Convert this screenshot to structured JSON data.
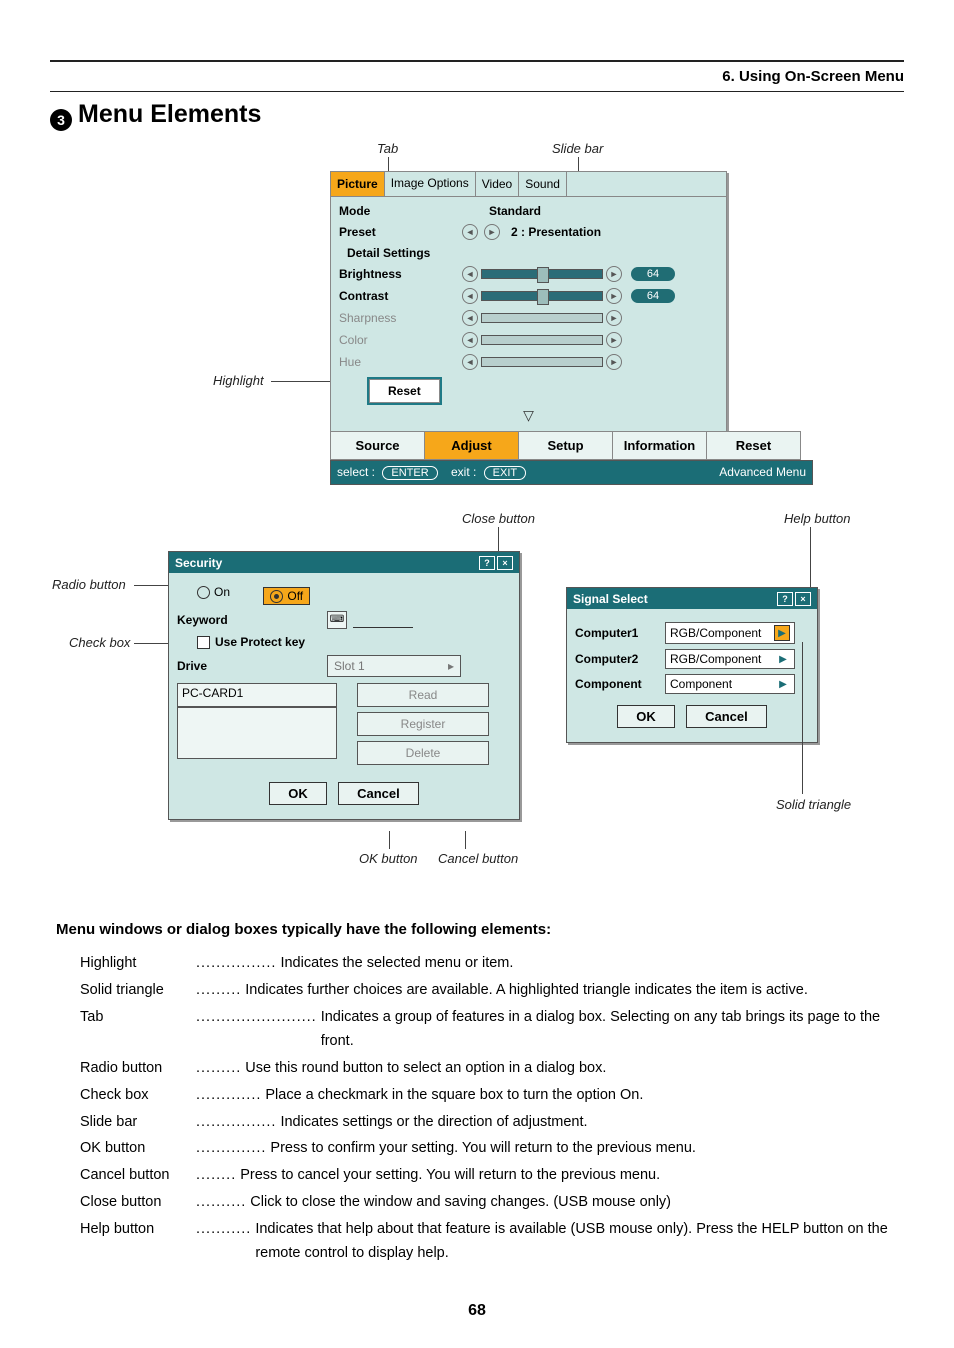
{
  "chapter": "6. Using On-Screen Menu",
  "section_number": "3",
  "section_title": "Menu Elements",
  "page_number": "68",
  "callouts": {
    "tab": "Tab",
    "slide_bar": "Slide bar",
    "highlight": "Highlight",
    "close_button": "Close button",
    "help_button": "Help button",
    "radio_button": "Radio button",
    "check_box": "Check box",
    "solid_triangle": "Solid triangle",
    "ok_button": "OK button",
    "cancel_button": "Cancel button"
  },
  "osd": {
    "tabs": [
      "Picture",
      "Image Options",
      "Video",
      "Sound"
    ],
    "rows": {
      "mode": {
        "label": "Mode",
        "value": "Standard"
      },
      "preset": {
        "label": "Preset",
        "value": "2 : Presentation"
      },
      "detail": {
        "label": "Detail Settings"
      },
      "brightness": {
        "label": "Brightness",
        "value": "64"
      },
      "contrast": {
        "label": "Contrast",
        "value": "64"
      },
      "sharpness": {
        "label": "Sharpness"
      },
      "color": {
        "label": "Color"
      },
      "hue": {
        "label": "Hue"
      },
      "reset": {
        "label": "Reset"
      }
    },
    "main_tabs": [
      "Source",
      "Adjust",
      "Setup",
      "Information",
      "Reset"
    ],
    "status": {
      "select": "select :",
      "select_btn": "ENTER",
      "exit": "exit :",
      "exit_btn": "EXIT",
      "right": "Advanced Menu"
    }
  },
  "security": {
    "title": "Security",
    "on": "On",
    "off": "Off",
    "keyword": "Keyword",
    "use_protect": "Use Protect key",
    "drive": "Drive",
    "drive_val": "Slot 1",
    "pc_card": "PC-CARD1",
    "buttons": {
      "read": "Read",
      "register": "Register",
      "delete": "Delete"
    },
    "ok": "OK",
    "cancel": "Cancel"
  },
  "signal": {
    "title": "Signal Select",
    "rows": [
      {
        "label": "Computer1",
        "value": "RGB/Component"
      },
      {
        "label": "Computer2",
        "value": "RGB/Component"
      },
      {
        "label": "Component",
        "value": "Component"
      }
    ],
    "ok": "OK",
    "cancel": "Cancel"
  },
  "subtitle": "Menu windows or dialog boxes typically have the following elements:",
  "definitions": [
    {
      "term": "Highlight",
      "dots": "................",
      "desc": "Indicates the selected menu or item."
    },
    {
      "term": "Solid triangle",
      "dots": ".........",
      "desc": "Indicates further choices are available. A highlighted triangle indicates the item is active."
    },
    {
      "term": "Tab",
      "dots": "........................",
      "desc": "Indicates a group of features in a dialog box. Selecting on any tab brings its page to the front."
    },
    {
      "term": "Radio button",
      "dots": ".........",
      "desc": "Use this round button to select an option in a dialog box."
    },
    {
      "term": "Check box",
      "dots": ".............",
      "desc": "Place a checkmark in the square box to turn the option On."
    },
    {
      "term": "Slide bar",
      "dots": "................",
      "desc": "Indicates settings or the direction of adjustment."
    },
    {
      "term": "OK button",
      "dots": "..............",
      "desc": "Press to confirm your setting. You will return to the previous menu."
    },
    {
      "term": "Cancel button",
      "dots": "........",
      "desc": "Press to cancel your setting. You will return to the previous menu."
    },
    {
      "term": "Close button",
      "dots": "..........",
      "desc": "Click to close the window and saving changes. (USB mouse only)"
    },
    {
      "term": "Help button",
      "dots": "...........",
      "desc": "Indicates that help about that feature is available (USB mouse only). Press the HELP button on the remote control to display help."
    }
  ]
}
